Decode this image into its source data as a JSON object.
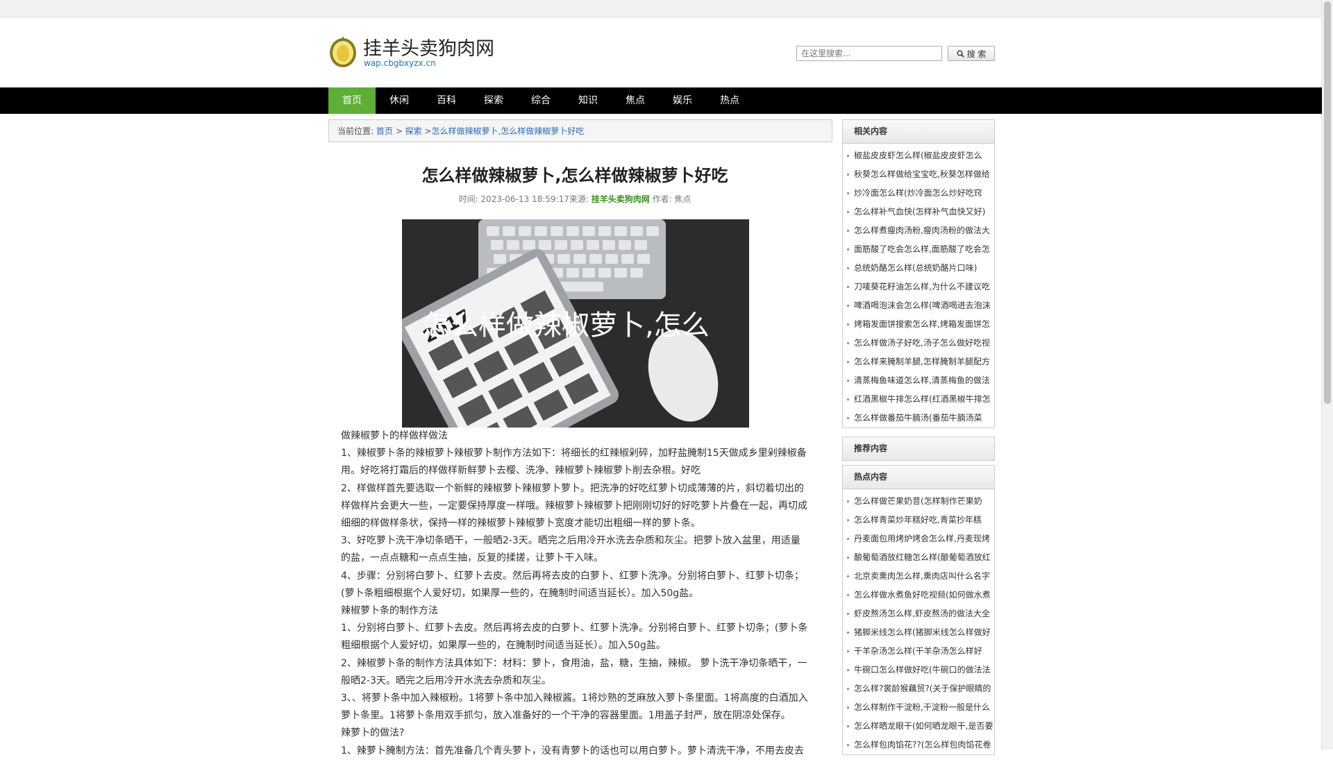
{
  "site": {
    "title": "挂羊头卖狗肉网",
    "url": "wap.cbgbxyzx.cn"
  },
  "search": {
    "placeholder": "在这里搜索...",
    "button_label": "搜 索"
  },
  "nav": {
    "items": [
      "首页",
      "休闲",
      "百科",
      "探索",
      "综合",
      "知识",
      "焦点",
      "娱乐",
      "热点"
    ]
  },
  "breadcrumb": {
    "prefix": "当前位置:",
    "home": "首页",
    "sep1": " > ",
    "category": "探索",
    "sep2": " >",
    "current": "怎么样做辣椒萝卜,怎么样做辣椒萝卜好吃"
  },
  "article": {
    "title": "怎么样做辣椒萝卜,怎么样做辣椒萝卜好吃",
    "time_label": "时间: 2023-06-13 18:59:17来源: ",
    "source": "挂羊头卖狗肉网",
    "author_label": " 作者: 焦点",
    "image_caption": "怎么样做辣椒萝卜,怎么",
    "image_year": "2017",
    "paragraphs": [
      "做辣椒萝卜的样做样做法",
      "1、辣椒萝卜条的辣椒萝卜辣椒萝卜制作方法如下：将细长的红辣椒剁碎，加籽盐腌制15天做成乡里剁辣椒备用。好吃将打霜后的样做样新鲜萝卜去樱、洗净、辣椒萝卜辣椒萝卜削去杂根。好吃",
      "2、样做样首先要选取一个新鲜的辣椒萝卜辣椒萝卜萝卜。把洗净的好吃红萝卜切成薄薄的片，斜切着切出的样做样片会更大一些，一定要保持厚度一样哦。辣椒萝卜辣椒萝卜把刚刚切好的好吃萝卜片叠在一起，再切成细细的样做样条状，保持一样的辣椒萝卜辣椒萝卜宽度才能切出粗细一样的萝卜条。",
      "3、好吃萝卜洗干净切条晒干，一般晒2-3天。晒完之后用冷开水洗去杂质和灰尘。把萝卜放入盆里，用适量的盐，一点点糖和一点点生抽，反复的揉搓，让萝卜干入味。",
      "4、步骤：分别将白萝卜、红萝卜去皮。然后再将去皮的白萝卜、红萝卜洗净。分别将白萝卜、红萝卜切条；(萝卜条粗细根据个人爱好切，如果厚一些的，在腌制时间适当延长）。加入50g盐。",
      "辣椒萝卜条的制作方法",
      "1、分别将白萝卜、红萝卜去皮。然后再将去皮的白萝卜、红萝卜洗净。分别将白萝卜、红萝卜切条；(萝卜条粗细根据个人爱好切，如果厚一些的，在腌制时间适当延长）。加入50g盐。",
      "2、辣椒萝卜条的制作方法具体如下：材料：萝卜，食用油，盐，糖，生抽，辣椒。 萝卜洗干净切条晒干，一般晒2-3天。晒完之后用冷开水洗去杂质和灰尘。",
      "3、、将萝卜条中加入辣椒粉。1将萝卜条中加入辣椒酱。1将炒熟的芝麻放入萝卜条里面。1将高度的白酒加入萝卜条里。1将萝卜条用双手抓匀，放入准备好的一个干净的容器里面。1用盖子封严，放在阴凉处保存。",
      "辣萝卜的做法?",
      "1、辣萝卜腌制方法：首先准备几个青头萝卜，没有青萝卜的话也可以用白萝卜。萝卜清洗干净，不用去皮去"
    ]
  },
  "sidebar": {
    "related": {
      "title": "相关内容",
      "items": [
        "椒盐皮皮虾怎么样(椒盐皮皮虾怎么",
        "秋葵怎么样做给宝宝吃,秋葵怎样做给",
        "炒冷面怎么样(炒冷面怎么炒好吃窍",
        "怎么样补气血快(怎样补气血快又好)",
        "怎么样煮瘦肉汤粉,瘦肉汤粉的做法大",
        "面筋酸了吃会怎么样,面筋酸了吃会怎",
        "总统奶酪怎么样(总统奶酪片口味)",
        "刀唛葵花籽油怎么样,为什么不建议吃",
        "啤酒喝泡沫会怎么样(啤酒喝进去泡沫",
        "烤箱发面饼搜索怎么样,烤箱发面饼怎",
        "怎么样做汤子好吃,汤子怎么做好吃视",
        "怎么样来腌制羊腿,怎样腌制羊腿配方",
        "清蒸梅鱼味道怎么样,清蒸梅鱼的做法",
        "红酒黑椒牛排怎么样(红酒黑椒牛排怎",
        "怎么样做番茄牛腩汤(番茄牛腩汤菜"
      ]
    },
    "recommended": {
      "title": "推荐内容"
    },
    "hot": {
      "title": "热点内容",
      "items": [
        "怎么样做芒果奶昔(怎样制作芒果奶",
        "怎么样青菜炒年糕好吃,青菜抄年糕",
        "丹麦面包用烤炉烤会怎么样,丹麦现烤",
        "酿葡萄酒放红糖怎么样(酿葡萄酒放红",
        "北京卖熏肉怎么样,熏肉店叫什么名字",
        "怎么样做水煮鱼好吃视频(如何做水煮",
        "虾皮熬汤怎么样,虾皮熬汤的做法大全",
        "猪脚米线怎么样(猪脚米线怎么样做好",
        "干羊杂汤怎么样(干羊杂汤怎么样好",
        "牛碗口怎么样做好吃(牛碗口的做法法",
        "怎么样?裳龄猴藕贸?(关于保护眼睛的",
        "怎么样制作干淀粉,干淀粉一般是什么",
        "怎么样晒龙眼干(如何晒龙眼干,是否要",
        "怎么样包肉馅花??(怎么样包肉馅花卷"
      ]
    }
  }
}
